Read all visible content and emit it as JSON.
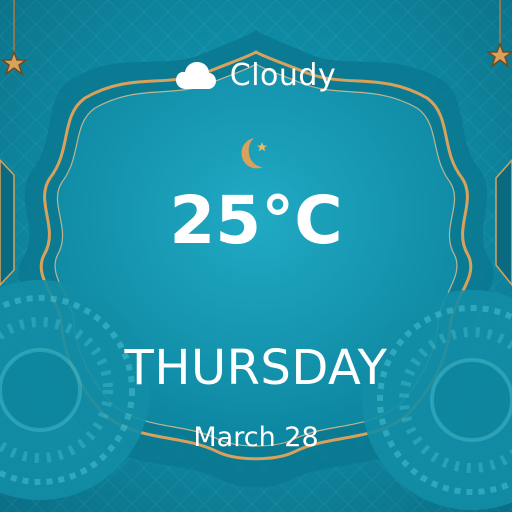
{
  "weather": {
    "condition": "Cloudy",
    "icon": "cloud-icon",
    "temperature": "25°C"
  },
  "decor": {
    "moon_icon": "crescent-moon-star-icon"
  },
  "calendar": {
    "day": "THURSDAY",
    "date": "March 28"
  },
  "colors": {
    "background": "#0f8ea7",
    "frame_gold": "#d8a15c",
    "text": "#ffffff"
  }
}
